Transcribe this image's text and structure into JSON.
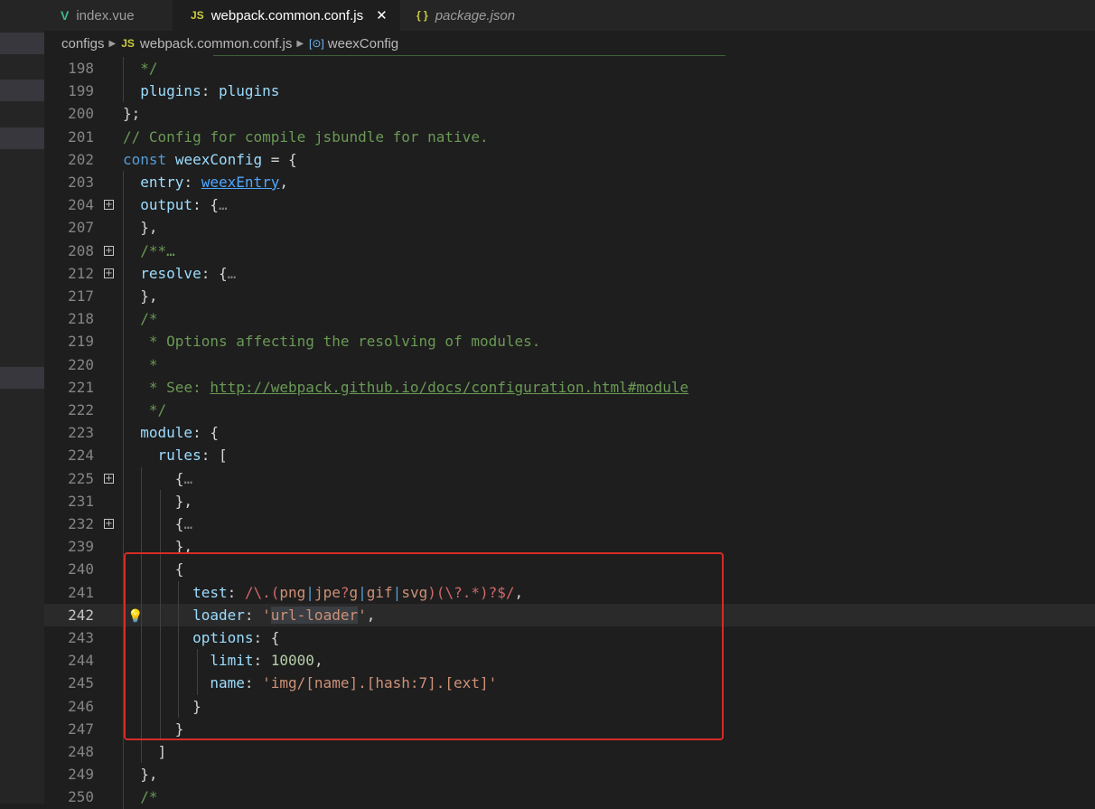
{
  "tabs": [
    {
      "label": "index.vue",
      "icon": "vue-icon",
      "active": false,
      "italic": false
    },
    {
      "label": "webpack.common.conf.js",
      "icon": "js-icon",
      "active": true,
      "italic": false
    },
    {
      "label": "package.json",
      "icon": "json-icon",
      "active": false,
      "italic": true
    }
  ],
  "icons": {
    "vue": "V",
    "js": "JS",
    "json": "{ }",
    "close": "✕",
    "chevron": "▶",
    "symbol": "[⊙]",
    "fold": "+",
    "bulb": "💡"
  },
  "breadcrumb": [
    "configs",
    "webpack.common.conf.js",
    "weexConfig"
  ],
  "current_line": "242",
  "lines": [
    {
      "ln": "198",
      "code": "  */"
    },
    {
      "ln": "199",
      "code": "  plugins: plugins"
    },
    {
      "ln": "200",
      "code": "};"
    },
    {
      "ln": "201",
      "code": "// Config for compile jsbundle for native."
    },
    {
      "ln": "202",
      "code": "const weexConfig = {"
    },
    {
      "ln": "203",
      "code": "  entry: weexEntry,"
    },
    {
      "ln": "204",
      "code": "  output: {…",
      "fold": true
    },
    {
      "ln": "207",
      "code": "  },"
    },
    {
      "ln": "208",
      "code": "  /**…",
      "fold": true
    },
    {
      "ln": "212",
      "code": "  resolve: {…",
      "fold": true
    },
    {
      "ln": "217",
      "code": "  },"
    },
    {
      "ln": "218",
      "code": "  /*"
    },
    {
      "ln": "219",
      "code": "   * Options affecting the resolving of modules."
    },
    {
      "ln": "220",
      "code": "   *"
    },
    {
      "ln": "221",
      "code": "   * See: http://webpack.github.io/docs/configuration.html#module"
    },
    {
      "ln": "222",
      "code": "   */"
    },
    {
      "ln": "223",
      "code": "  module: {"
    },
    {
      "ln": "224",
      "code": "    rules: ["
    },
    {
      "ln": "225",
      "code": "      {…",
      "fold": true
    },
    {
      "ln": "231",
      "code": "      },"
    },
    {
      "ln": "232",
      "code": "      {…",
      "fold": true
    },
    {
      "ln": "239",
      "code": "      },"
    },
    {
      "ln": "240",
      "code": "      {"
    },
    {
      "ln": "241",
      "code": "        test: /\\.(png|jpe?g|gif|svg)(\\?.*)?$/,"
    },
    {
      "ln": "242",
      "code": "        loader: 'url-loader',"
    },
    {
      "ln": "243",
      "code": "        options: {"
    },
    {
      "ln": "244",
      "code": "          limit: 10000,"
    },
    {
      "ln": "245",
      "code": "          name: 'img/[name].[hash:7].[ext]'"
    },
    {
      "ln": "246",
      "code": "        }"
    },
    {
      "ln": "247",
      "code": "      }"
    },
    {
      "ln": "248",
      "code": "    ]"
    },
    {
      "ln": "249",
      "code": "  },"
    },
    {
      "ln": "250",
      "code": "  /*"
    }
  ],
  "colors": {
    "background": "#1e1e1e",
    "keyword": "#569cd6",
    "comment": "#6a9955",
    "string": "#ce9178",
    "number": "#b5cea8",
    "highlight_box": "#d42c25"
  }
}
